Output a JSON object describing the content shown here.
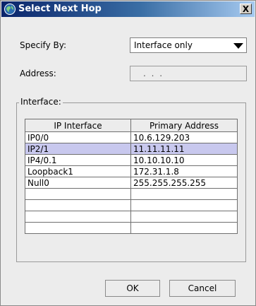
{
  "window": {
    "title": "Select Next Hop",
    "close_label": "X",
    "title_icon": "globe-icon"
  },
  "form": {
    "specify_by_label": "Specify By:",
    "specify_by_value": "Interface only",
    "address_label": "Address:",
    "address_value": ". . ."
  },
  "interface_group": {
    "legend": "Interface:",
    "columns": [
      "IP Interface",
      "Primary Address"
    ],
    "rows": [
      {
        "interface": "IP0/0",
        "address": "10.6.129.203"
      },
      {
        "interface": "IP2/1",
        "address": "11.11.11.11"
      },
      {
        "interface": "IP4/0.1",
        "address": "10.10.10.10"
      },
      {
        "interface": "Loopback1",
        "address": "172.31.1.8"
      },
      {
        "interface": "Null0",
        "address": "255.255.255.255"
      },
      {
        "interface": "",
        "address": ""
      },
      {
        "interface": "",
        "address": ""
      },
      {
        "interface": "",
        "address": ""
      },
      {
        "interface": "",
        "address": ""
      }
    ],
    "selected_row": 1,
    "selected_color": "#c8c8ee"
  },
  "buttons": {
    "ok": "OK",
    "cancel": "Cancel"
  }
}
